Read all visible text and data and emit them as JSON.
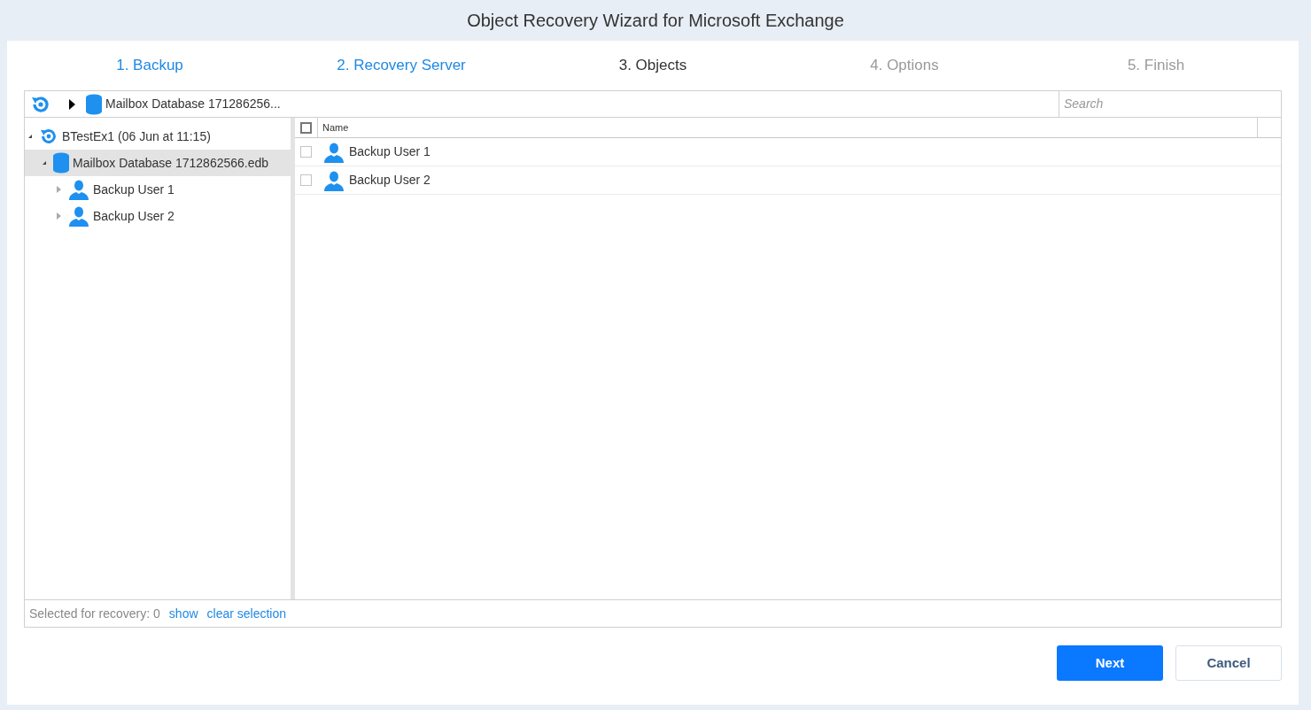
{
  "window": {
    "title": "Object Recovery Wizard for Microsoft Exchange"
  },
  "steps": [
    {
      "label": "1. Backup",
      "completed": true,
      "selected": false
    },
    {
      "label": "2. Recovery Server",
      "completed": true,
      "selected": false
    },
    {
      "label": "3. Objects",
      "completed": false,
      "selected": true
    },
    {
      "label": "4. Options",
      "completed": false,
      "selected": false
    },
    {
      "label": "5. Finish",
      "completed": false,
      "selected": false
    }
  ],
  "breadcrumb": {
    "label": "Mailbox Database 171286256..."
  },
  "search": {
    "placeholder": "Search"
  },
  "tree": [
    {
      "kind": "backup",
      "label": "BTestEx1 (06 Jun at 11:15)",
      "expanded": true,
      "selected": false,
      "children": [
        {
          "kind": "database",
          "label": "Mailbox Database 1712862566.edb",
          "expanded": true,
          "selected": true,
          "children": [
            {
              "kind": "user",
              "label": "Backup User 1",
              "expanded": false,
              "selected": false
            },
            {
              "kind": "user",
              "label": "Backup User 2",
              "expanded": false,
              "selected": false
            }
          ]
        }
      ]
    }
  ],
  "table": {
    "columns": [
      "Name"
    ],
    "header_checked": false,
    "rows": [
      {
        "name": "Backup User 1",
        "checked": false
      },
      {
        "name": "Backup User 2",
        "checked": false
      }
    ]
  },
  "footer": {
    "summary": "Selected for recovery: 0",
    "links": [
      "show",
      "clear selection"
    ]
  },
  "buttons": [
    {
      "label": "Next",
      "kind": "primary"
    },
    {
      "label": "Cancel",
      "kind": "secondary"
    }
  ]
}
